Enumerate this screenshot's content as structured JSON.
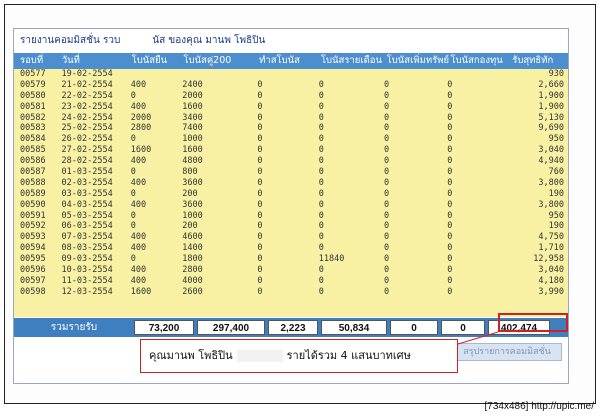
{
  "report": {
    "title_left": "รายงานคอมมิสชั่น รวบ",
    "title_right": "นัส ของคุณ มานพ โพธิปิน"
  },
  "columns": [
    "รอบที่",
    "วันที่",
    "โบนัสยืน",
    "โบนัสคู่200",
    "ทำสโบนัส",
    "โบนัสรายเดือน",
    "โบนัสเพิ่มทรัพย์",
    "โบนัสกองทุน",
    "รับสุทธิทัก"
  ],
  "rows": [
    [
      "00577",
      "19-02-2554",
      "",
      "",
      "",
      "",
      "",
      "",
      "930"
    ],
    [
      "00579",
      "21-02-2554",
      "400",
      "2400",
      "0",
      "0",
      "0",
      "0",
      "2,660"
    ],
    [
      "00580",
      "22-02-2554",
      "0",
      "2000",
      "0",
      "0",
      "0",
      "0",
      "1,900"
    ],
    [
      "00581",
      "23-02-2554",
      "400",
      "1600",
      "0",
      "0",
      "0",
      "0",
      "1,900"
    ],
    [
      "00582",
      "24-02-2554",
      "2000",
      "3400",
      "0",
      "0",
      "0",
      "0",
      "5,130"
    ],
    [
      "00583",
      "25-02-2554",
      "2800",
      "7400",
      "0",
      "0",
      "0",
      "0",
      "9,690"
    ],
    [
      "00584",
      "26-02-2554",
      "0",
      "1000",
      "0",
      "0",
      "0",
      "0",
      "950"
    ],
    [
      "00585",
      "27-02-2554",
      "1600",
      "1600",
      "0",
      "0",
      "0",
      "0",
      "3,040"
    ],
    [
      "00586",
      "28-02-2554",
      "400",
      "4800",
      "0",
      "0",
      "0",
      "0",
      "4,940"
    ],
    [
      "00587",
      "01-03-2554",
      "0",
      "800",
      "0",
      "0",
      "0",
      "0",
      "760"
    ],
    [
      "00588",
      "02-03-2554",
      "400",
      "3600",
      "0",
      "0",
      "0",
      "0",
      "3,800"
    ],
    [
      "00589",
      "03-03-2554",
      "0",
      "200",
      "0",
      "0",
      "0",
      "0",
      "190"
    ],
    [
      "00590",
      "04-03-2554",
      "400",
      "3600",
      "0",
      "0",
      "0",
      "0",
      "3,800"
    ],
    [
      "00591",
      "05-03-2554",
      "0",
      "1000",
      "0",
      "0",
      "0",
      "0",
      "950"
    ],
    [
      "00592",
      "06-03-2554",
      "0",
      "200",
      "0",
      "0",
      "0",
      "0",
      "190"
    ],
    [
      "00593",
      "07-03-2554",
      "400",
      "4600",
      "0",
      "0",
      "0",
      "0",
      "4,750"
    ],
    [
      "00594",
      "08-03-2554",
      "400",
      "1400",
      "0",
      "0",
      "0",
      "0",
      "1,710"
    ],
    [
      "00595",
      "09-03-2554",
      "0",
      "1800",
      "0",
      "11840",
      "0",
      "0",
      "12,958"
    ],
    [
      "00596",
      "10-03-2554",
      "400",
      "2800",
      "0",
      "0",
      "0",
      "0",
      "3,040"
    ],
    [
      "00597",
      "11-03-2554",
      "400",
      "4000",
      "0",
      "0",
      "0",
      "0",
      "4,180"
    ],
    [
      "00598",
      "12-03-2554",
      "1600",
      "2600",
      "0",
      "0",
      "0",
      "0",
      "3,990"
    ]
  ],
  "totals": {
    "label": "รวมรายรับ",
    "values": [
      "73,200",
      "297,400",
      "2,223",
      "50,834",
      "0",
      "0",
      "402,474"
    ]
  },
  "bottom_button": "สรุปรายการคอมมิสชั่น",
  "callout": {
    "name": "คุณมานพ โพธิปิน",
    "text": "รายได้รวม 4 แสนบาทเศษ"
  },
  "watermark": "[734x486] http://upic.me/",
  "colors": {
    "header": "#4d8fce",
    "rows_bg": "#f8f1a4",
    "totals_bar": "#3f7fc0",
    "highlight": "#cc2222"
  }
}
